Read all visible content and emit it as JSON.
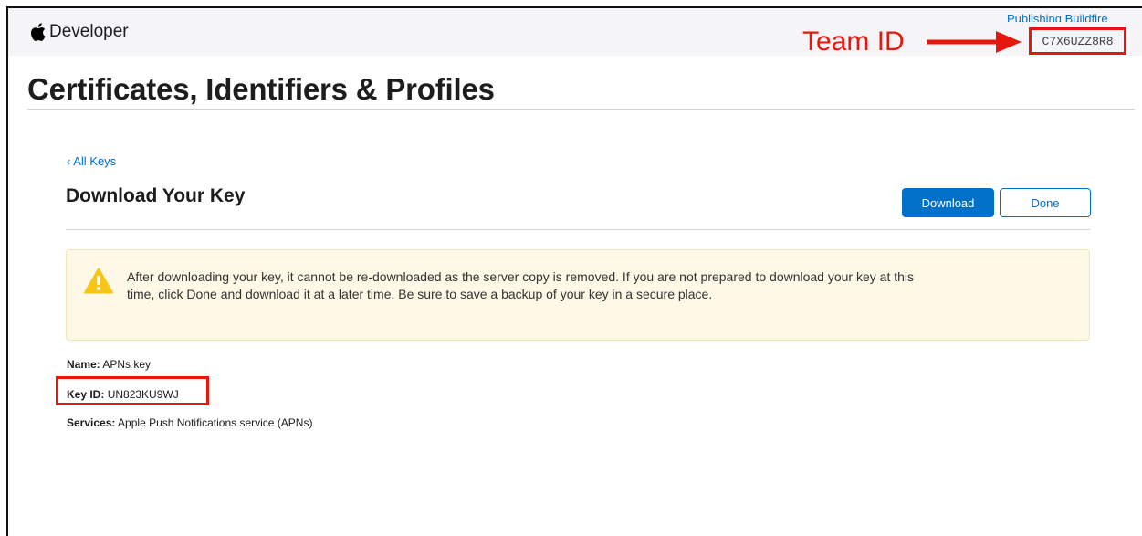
{
  "header": {
    "brand_label": "Developer",
    "account_name": "Publishing Buildfire",
    "team_id": "C7X6UZZ8R8"
  },
  "annotations": {
    "team_id_label": "Team ID",
    "color": "#e8170e"
  },
  "page": {
    "title": "Certificates, Identifiers & Profiles"
  },
  "key_page": {
    "back_link": "‹ All Keys",
    "title": "Download Your Key",
    "download_label": "Download",
    "done_label": "Done",
    "warning_text": "After downloading your key, it cannot be re-downloaded as the server copy is removed. If you are not prepared to download your key at this time, click Done and download it at a later time. Be sure to save a backup of your key in a secure place.",
    "details": {
      "name_label": "Name:",
      "name_value": "APNs key",
      "keyid_label": "Key ID:",
      "keyid_value": "UN823KU9WJ",
      "services_label": "Services:",
      "services_value": "Apple Push Notifications service (APNs)"
    }
  },
  "colors": {
    "accent": "#0070c9",
    "warning_bg": "#fef8e6",
    "warning_icon": "#f5c518",
    "header_bg": "#f5f5f7"
  },
  "icons": [
    "apple-logo-icon",
    "warning-icon",
    "arrow-right-icon"
  ]
}
